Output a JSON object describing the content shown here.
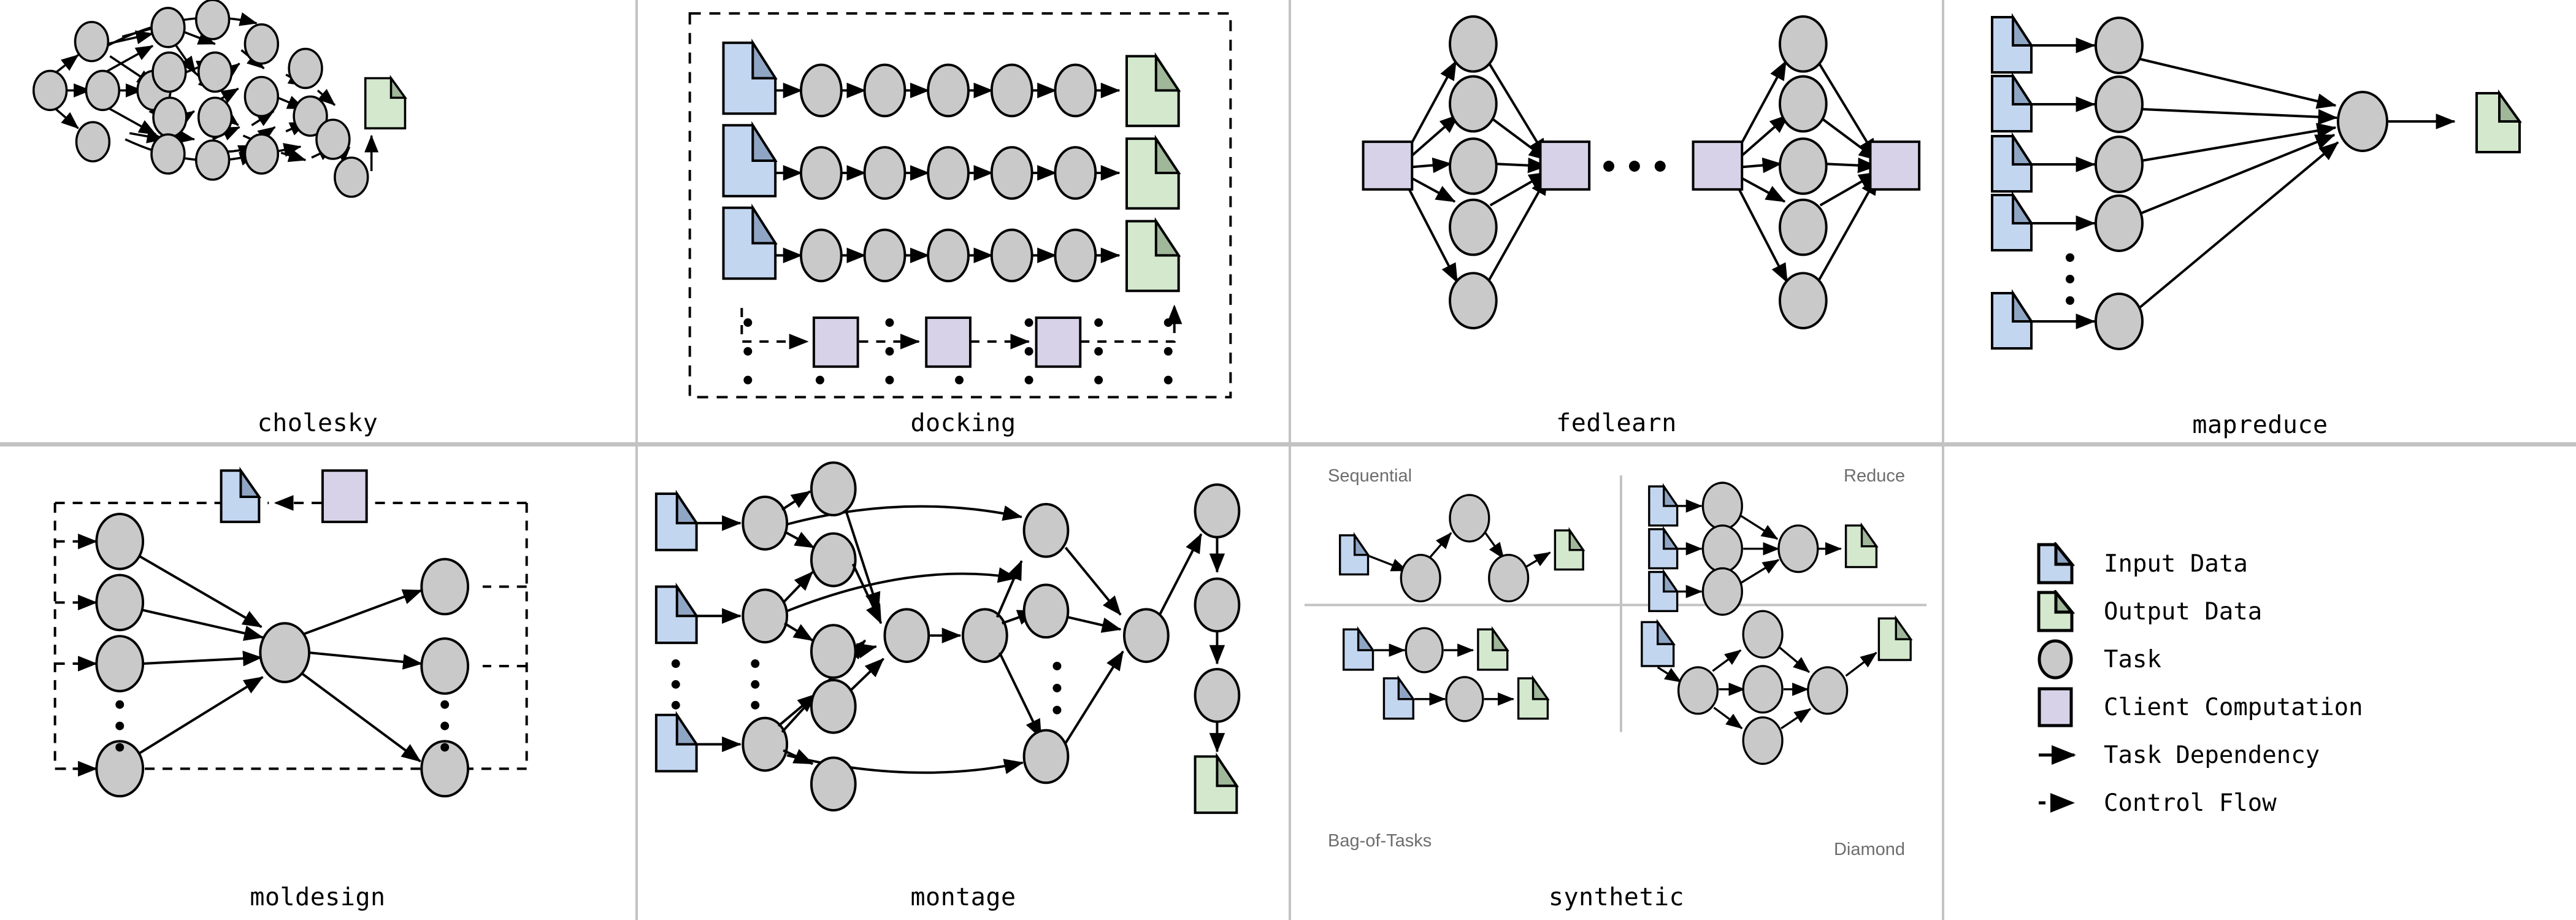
{
  "figure": {
    "title_font": "monospace",
    "panels": [
      {
        "id": "cholesky",
        "label": "cholesky"
      },
      {
        "id": "docking",
        "label": "docking"
      },
      {
        "id": "fedlearn",
        "label": "fedlearn"
      },
      {
        "id": "mapreduce",
        "label": "mapreduce"
      },
      {
        "id": "moldesign",
        "label": "moldesign"
      },
      {
        "id": "montage",
        "label": "montage"
      },
      {
        "id": "synthetic",
        "label": "synthetic"
      },
      {
        "id": "legend",
        "label": ""
      }
    ]
  },
  "colors": {
    "input_data": "#c3d6f0",
    "input_data_fold": "#8fa5c4",
    "output_data": "#d3e8cd",
    "output_data_fold": "#a0b79a",
    "task": "#c9c9c9",
    "client_computation": "#d8d2e8",
    "stroke": "#000000",
    "divider": "#c3c3c3",
    "sublabel_text": "#6d6d6d",
    "label_text": "#000000"
  },
  "legend": {
    "items": [
      {
        "glyph": "input-data-icon",
        "label": "Input Data"
      },
      {
        "glyph": "output-data-icon",
        "label": "Output Data"
      },
      {
        "glyph": "task-icon",
        "label": "Task"
      },
      {
        "glyph": "client-computation-icon",
        "label": "Client Computation"
      },
      {
        "glyph": "solid-arrow-icon",
        "label": "Task Dependency"
      },
      {
        "glyph": "dashed-arrow-icon",
        "label": "Control Flow"
      }
    ]
  },
  "synthetic": {
    "sub_labels": [
      {
        "text": "Sequential",
        "pos": "top-left"
      },
      {
        "text": "Reduce",
        "pos": "top-right"
      },
      {
        "text": "Bag-of-Tasks",
        "pos": "bottom-left"
      },
      {
        "text": "Diamond",
        "pos": "bottom-right"
      }
    ]
  },
  "chart_data": {
    "type": "diagram",
    "diagram_kind": "workflow-dag-gallery",
    "panels": [
      {
        "name": "cholesky",
        "node_counts": {
          "task": 19,
          "input_data": 0,
          "output_data": 1,
          "client_computation": 0
        },
        "description": "Dense irregular DAG of 19 tasks feeding a single output data artifact.",
        "edge_style": "solid",
        "has_ellipsis": false
      },
      {
        "name": "docking",
        "node_counts": {
          "task": 15,
          "input_data": 3,
          "output_data": 3,
          "client_computation": 3
        },
        "rows": 3,
        "tasks_per_row": 5,
        "description": "Three parallel input-to-output pipelines inside a dashed control-flow box; a chain of three client computations loops back into the box.",
        "edge_style": "solid-inside-dashed-outside",
        "has_ellipsis": true,
        "ellipsis_columns": 7
      },
      {
        "name": "fedlearn",
        "node_counts": {
          "task": 10,
          "input_data": 0,
          "output_data": 0,
          "client_computation": 4
        },
        "rounds": 2,
        "tasks_per_round": 5,
        "description": "Two federated rounds; each broadcasts from a client computation to five tasks which aggregate into another client computation. Ellipsis between rounds.",
        "edge_style": "solid",
        "has_ellipsis": true
      },
      {
        "name": "mapreduce",
        "node_counts": {
          "task": 6,
          "input_data": 5,
          "output_data": 1,
          "client_computation": 0
        },
        "mappers": 5,
        "reducers": 1,
        "description": "Five input data files each feed a map task; all map tasks reduce into one task producing one output data file. Vertical ellipsis between mappers 4 and 5.",
        "edge_style": "solid",
        "has_ellipsis": true
      },
      {
        "name": "moldesign",
        "node_counts": {
          "task": 9,
          "input_data": 1,
          "output_data": 0,
          "client_computation": 1
        },
        "description": "Simulation tasks converge on a central task that fans out to evaluation tasks; dashed control flow returns through a client computation to an input data artifact.",
        "edge_style": "mixed",
        "has_ellipsis": true
      },
      {
        "name": "montage",
        "node_counts": {
          "task": 17,
          "input_data": 3,
          "output_data": 1,
          "client_computation": 0
        },
        "description": "Astronomy image mosaic workflow: input images are projected, differenced, fitted, background-corrected, co-added and finally shrunk into one output image.",
        "edge_style": "solid",
        "has_ellipsis": true
      },
      {
        "name": "synthetic",
        "sub_panels": [
          {
            "name": "Sequential",
            "node_counts": {
              "task": 3,
              "input_data": 1,
              "output_data": 1,
              "client_computation": 0
            }
          },
          {
            "name": "Reduce",
            "node_counts": {
              "task": 4,
              "input_data": 3,
              "output_data": 1,
              "client_computation": 0
            }
          },
          {
            "name": "Bag-of-Tasks",
            "node_counts": {
              "task": 2,
              "input_data": 2,
              "output_data": 2,
              "client_computation": 0
            }
          },
          {
            "name": "Diamond",
            "node_counts": {
              "task": 5,
              "input_data": 1,
              "output_data": 1,
              "client_computation": 0
            }
          }
        ],
        "edge_style": "solid",
        "has_ellipsis": false
      }
    ],
    "legend_entries": [
      "Input Data",
      "Output Data",
      "Task",
      "Client Computation",
      "Task Dependency",
      "Control Flow"
    ]
  }
}
